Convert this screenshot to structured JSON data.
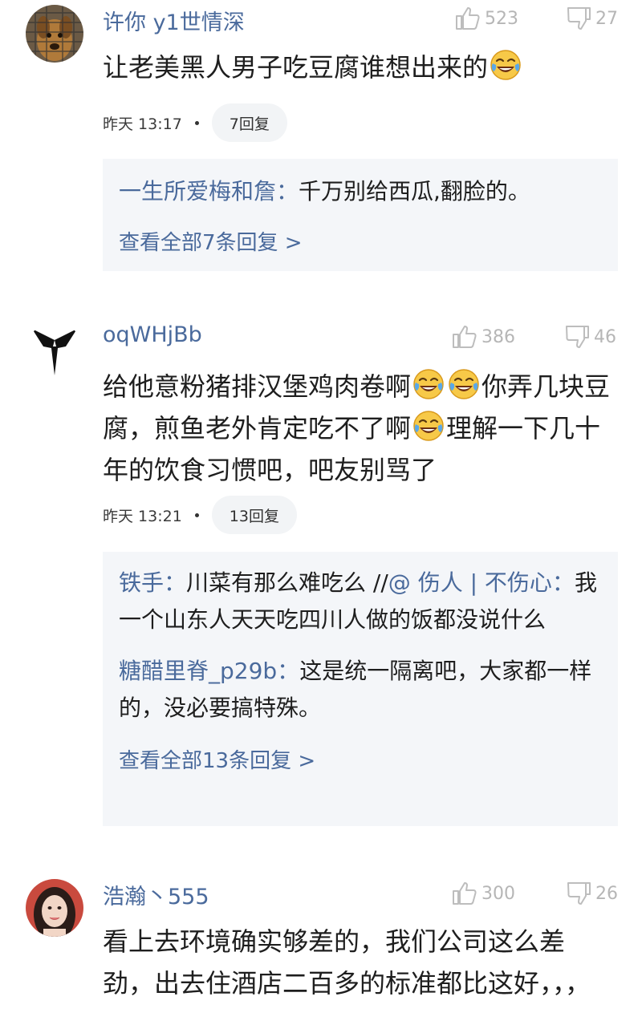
{
  "comments": [
    {
      "username": "许你 y1世情深",
      "likes": "523",
      "dislikes": "27",
      "text": "让老美黑人男子吃豆腐谁想出来的",
      "time": "昨天 13:17",
      "reply_count": "7回复",
      "replies": [
        {
          "author": "一生所爱梅和詹：",
          "text": "千万别给西瓜,翻脸的。"
        }
      ],
      "see_all": "查看全部7条回复 >"
    },
    {
      "username": "oqWHjBb",
      "likes": "386",
      "dislikes": "46",
      "text_parts": [
        "给他意粉猪排汉堡鸡肉卷啊",
        "你弄几块豆腐，煎鱼老外肯定吃不了啊",
        "理解一下几十年的饮食习惯吧，吧友别骂了"
      ],
      "time": "昨天 13:21",
      "reply_count": "13回复",
      "replies": [
        {
          "author": "铁手：",
          "text": "川菜有那么难吃么 //",
          "mention": "@ 伤人 | 不伤心：",
          "text2": "我一个山东人天天吃四川人做的饭都没说什么"
        },
        {
          "author": "糖醋里脊_p29b：",
          "text": "这是统一隔离吧，大家都一样的，没必要搞特殊。"
        }
      ],
      "see_all": "查看全部13条回复 >"
    },
    {
      "username": "浩瀚丶555",
      "likes": "300",
      "dislikes": "26",
      "text": "看上去环境确实够差的，我们公司这么差劲，出去住酒店二百多的标准都比这好，，，"
    }
  ],
  "icons": {
    "like": "thumbs-up-icon",
    "dislike": "thumbs-down-icon",
    "emoji": "tears-of-joy-emoji"
  },
  "colors": {
    "username": "#4a6a9c",
    "reply_bg": "#f4f6f9",
    "stat": "#b6b6b6"
  }
}
